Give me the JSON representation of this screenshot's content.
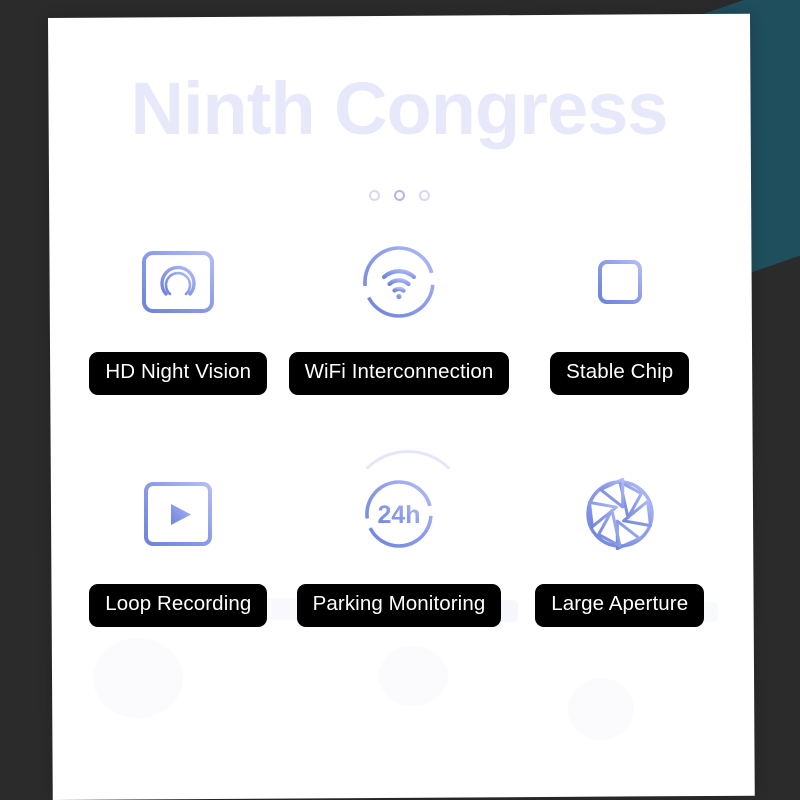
{
  "page": {
    "headline": "Ninth Congress",
    "background_color": "#2b2b2c",
    "accent_wedge_color": "#1f4e5c",
    "sheet_color": "#ffffff",
    "headline_color": "#e7e9fa",
    "icon_gradient_start": "#7b8fe0",
    "icon_gradient_end": "#aab6f2",
    "label_background": "#000000",
    "label_text_color": "#ffffff"
  },
  "carousel": {
    "dots": [
      {
        "name": "dot-1",
        "active": false
      },
      {
        "name": "dot-2",
        "active": true
      },
      {
        "name": "dot-3",
        "active": false
      }
    ]
  },
  "features": [
    {
      "icon": "night-vision-camera-icon",
      "label": "HD Night Vision"
    },
    {
      "icon": "wifi-interconnection-icon",
      "label": "WiFi Interconnection"
    },
    {
      "icon": "chip-icon",
      "label": "Stable Chip"
    },
    {
      "icon": "loop-recording-video-icon",
      "label": "Loop Recording"
    },
    {
      "icon": "24h-parking-monitor-icon",
      "label": "Parking Monitoring"
    },
    {
      "icon": "camera-aperture-icon",
      "label": "Large Aperture"
    }
  ],
  "icon_text": {
    "hours_badge": "24h"
  }
}
